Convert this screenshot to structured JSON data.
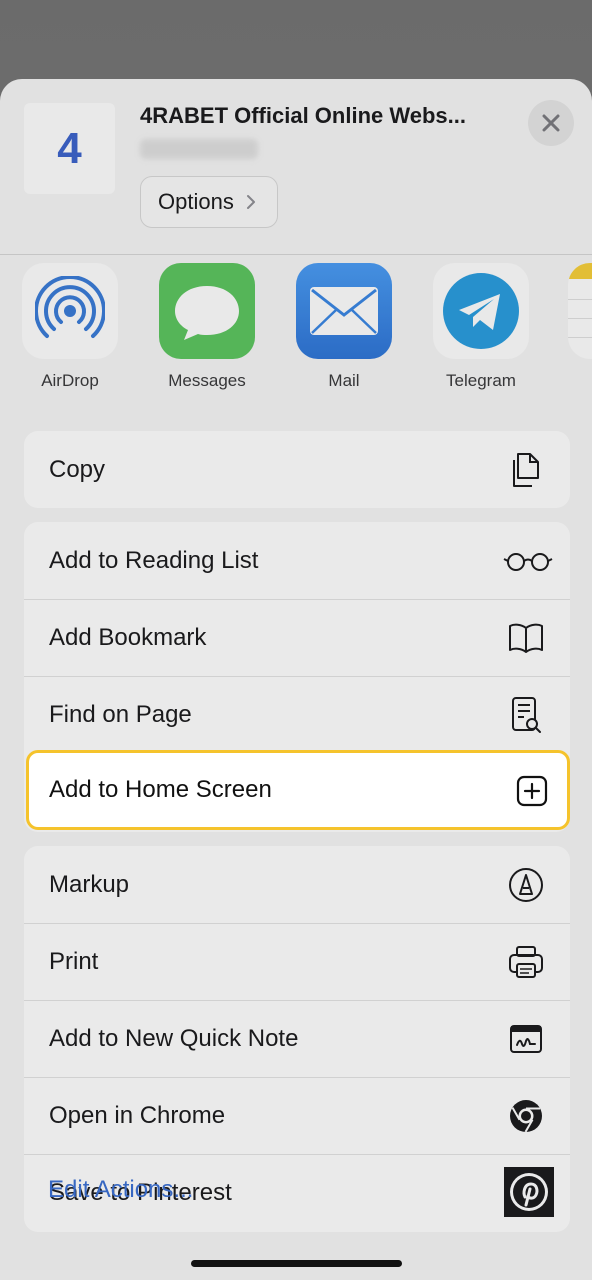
{
  "header": {
    "site_icon_letter": "4",
    "title": "4RABET Official Online Webs...",
    "options_label": "Options"
  },
  "apps": [
    {
      "label": "AirDrop",
      "icon": "airdrop-icon",
      "color": "#3a7bd5"
    },
    {
      "label": "Messages",
      "icon": "messages-icon",
      "color": "#4cbb55"
    },
    {
      "label": "Mail",
      "icon": "mail-icon",
      "color": "#3a85e0"
    },
    {
      "label": "Telegram",
      "icon": "telegram-icon",
      "color": "#2a9bdb"
    }
  ],
  "actions": {
    "copy": "Copy",
    "reading_list": "Add to Reading List",
    "bookmark": "Add Bookmark",
    "find": "Find on Page",
    "home_screen": "Add to Home Screen",
    "markup": "Markup",
    "print": "Print",
    "quick_note": "Add to New Quick Note",
    "chrome": "Open in Chrome",
    "pinterest": "Save to Pinterest"
  },
  "edit_actions_label": "Edit Actions...",
  "colors": {
    "highlight_border": "#f5c32c",
    "link": "#3b6fd0"
  }
}
